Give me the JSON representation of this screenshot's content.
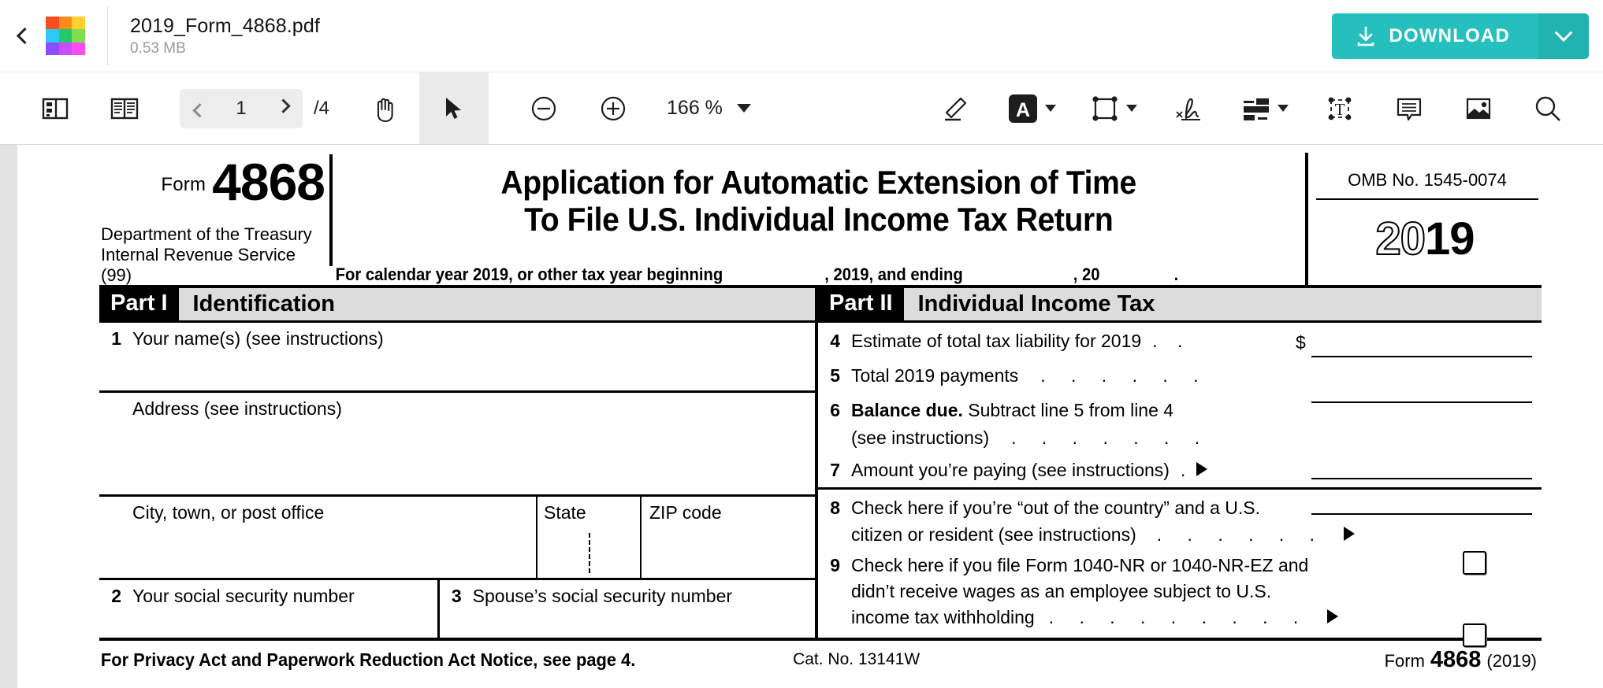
{
  "header": {
    "back_icon": "chevron-left-icon",
    "logo_colors": [
      "#fa4d1f",
      "#ff8c1a",
      "#ffd02e",
      "#2ec8f5",
      "#25c96b",
      "#7ddd4e",
      "#8c4dff",
      "#cc4dff",
      "#ff4df0"
    ],
    "file_name": "2019_Form_4868.pdf",
    "file_size": "0.53 MB",
    "download_label": "DOWNLOAD",
    "download_color": "#25c0bd",
    "download_icon": "download-icon",
    "download_caret_icon": "chevron-down-icon"
  },
  "toolbar": {
    "sidebar_toggle_icon": "sidebar-panel-icon",
    "page_layout_icon": "dual-page-icon",
    "prev_page_icon": "chevron-left-icon",
    "next_page_icon": "chevron-right-icon",
    "page_number": "1",
    "page_total": "/4",
    "hand_tool_icon": "hand-icon",
    "select_tool_icon": "cursor-arrow-icon",
    "zoom_out_icon": "minus-circle-icon",
    "zoom_in_icon": "plus-circle-icon",
    "zoom_level": "166 %",
    "zoom_dropdown_icon": "triangle-down-icon",
    "draw_icon": "pencil-icon",
    "text_style_icon": "text-A-icon",
    "text_style_dropdown_icon": "triangle-down-icon",
    "shape_icon": "rectangle-nodes-icon",
    "shape_dropdown_icon": "triangle-down-icon",
    "signature_icon": "signature-icon",
    "highlight_icon": "highlight-bars-icon",
    "highlight_dropdown_icon": "triangle-down-icon",
    "textbox_icon": "text-box-T-icon",
    "comment_icon": "comment-bubble-icon",
    "image_icon": "image-icon",
    "search_icon": "search-icon"
  },
  "document": {
    "form_label": "Form",
    "form_number": "4868",
    "dept_line1": "Department of the Treasury",
    "dept_line2": "Internal Revenue Service (99)",
    "title_line1": "Application for Automatic Extension of Time",
    "title_line2": "To File U.S. Individual Income Tax Return",
    "calendar_prefix": "For calendar year 2019, or other tax year beginning",
    "calendar_mid": ", 2019, and ending",
    "calendar_suffix": ", 20",
    "calendar_period": ".",
    "omb_number": "OMB No. 1545-0074",
    "year_outline": "20",
    "year_solid": "19",
    "part1_tag": "Part I",
    "part1_title": "Identification",
    "part2_tag": "Part II",
    "part2_title": "Individual Income Tax",
    "left_fields": {
      "line1_num": "1",
      "line1_label": "Your name(s) (see instructions)",
      "address_label": "Address (see instructions)",
      "city_label": "City, town, or post office",
      "state_label": "State",
      "zip_label": "ZIP code",
      "line2_num": "2",
      "line2_label": "Your social security number",
      "line3_num": "3",
      "line3_label": "Spouse’s social security number"
    },
    "right_fields": {
      "line4_num": "4",
      "line4_label": "Estimate of total tax liability for 2019",
      "line4_dots": ".   .",
      "line4_dollar": "$",
      "line5_num": "5",
      "line5_label": "Total 2019 payments",
      "line5_dots": ".   .    .    .    .    .",
      "line6_num": "6",
      "line6_label_bold": "Balance due.",
      "line6_label_rest": "Subtract  line 5 from  line 4",
      "line6_label2": "(see instructions)",
      "line6_dots": ".    .    .    .    .    .    .",
      "line7_num": "7",
      "line7_label": "Amount you’re paying (see instructions)",
      "line7_dot": ".",
      "line8_num": "8",
      "line8_label1": "Check here if you’re “out of the country” and a U.S.",
      "line8_label2": "citizen or resident (see instructions)",
      "line8_dots": ".     .     .     .     .     .",
      "line9_num": "9",
      "line9_label1": "Check here if you file Form 1040-NR or 1040-NR-EZ and",
      "line9_label2": "didn’t receive wages as an employee subject to U.S.",
      "line9_label3": "income tax withholding",
      "line9_dots": ".     .     .     .     .     .     .     .     ."
    },
    "footer": {
      "privacy_notice": "For Privacy Act and Paperwork Reduction Act Notice, see page 4.",
      "cat_no": "Cat. No. 13141W",
      "form_label": "Form",
      "form_number": "4868",
      "form_year": "(2019)"
    }
  }
}
